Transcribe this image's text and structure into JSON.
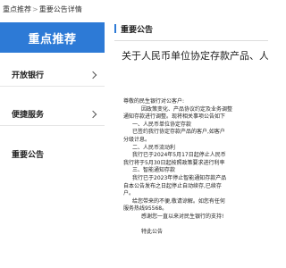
{
  "breadcrumb": {
    "home": "重点推荐",
    "current": "重要公告详情"
  },
  "sidebar": {
    "header": "重点推荐",
    "items": [
      {
        "label": "开放银行"
      },
      {
        "label": "便捷服务"
      },
      {
        "label": "重要公告"
      }
    ]
  },
  "main": {
    "section_title": "重要公告",
    "article_title": "关于人民币单位协定存款产品、人民",
    "body": [
      "尊敬的民生银行对公客户:",
      "因政策变化、产品协议约定及业务调整",
      "通知存款进行调整。现将相关事项公告如下",
      "一、人民币单位协定存款",
      "已签约我行协定存款产品的客户,如客户",
      "分级计息。",
      "二、人民币流动利",
      "我行已于2024年5月17日起停止人民币",
      "我行将于5月30日起按照政策要求进行利率",
      "三、智能通知存款",
      "我行已于2023年停止智能通知存款产品",
      "自本公告发布之日起停止自动续存,已续存",
      "户。",
      "给您带来的不便,敬请谅解。如您有任何",
      "服务热线95568。",
      "感谢您一直以来对民生银行的支持!",
      "特此公告"
    ]
  },
  "colors": {
    "accent": "#2d7ad6"
  }
}
